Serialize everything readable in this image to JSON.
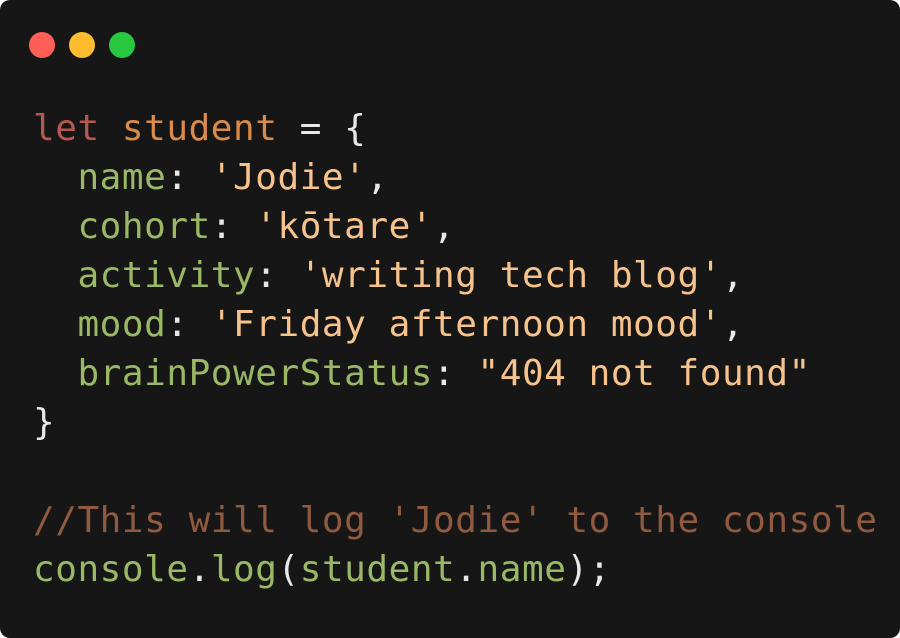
{
  "window": {
    "controls": [
      {
        "name": "close",
        "color": "#ff5f57"
      },
      {
        "name": "minimize",
        "color": "#febc2e"
      },
      {
        "name": "maximize",
        "color": "#28c840"
      }
    ]
  },
  "code": {
    "lines": [
      {
        "tokens": [
          {
            "type": "kw",
            "text": "let"
          },
          {
            "type": "punc",
            "text": " "
          },
          {
            "type": "var",
            "text": "student"
          },
          {
            "type": "punc",
            "text": " = {"
          }
        ]
      },
      {
        "tokens": [
          {
            "type": "punc",
            "text": "  "
          },
          {
            "type": "prop",
            "text": "name"
          },
          {
            "type": "punc",
            "text": ": "
          },
          {
            "type": "str",
            "text": "'Jodie'"
          },
          {
            "type": "punc",
            "text": ","
          }
        ]
      },
      {
        "tokens": [
          {
            "type": "punc",
            "text": "  "
          },
          {
            "type": "prop",
            "text": "cohort"
          },
          {
            "type": "punc",
            "text": ": "
          },
          {
            "type": "str",
            "text": "'kōtare'"
          },
          {
            "type": "punc",
            "text": ","
          }
        ]
      },
      {
        "tokens": [
          {
            "type": "punc",
            "text": "  "
          },
          {
            "type": "prop",
            "text": "activity"
          },
          {
            "type": "punc",
            "text": ": "
          },
          {
            "type": "str",
            "text": "'writing tech blog'"
          },
          {
            "type": "punc",
            "text": ","
          }
        ]
      },
      {
        "tokens": [
          {
            "type": "punc",
            "text": "  "
          },
          {
            "type": "prop",
            "text": "mood"
          },
          {
            "type": "punc",
            "text": ": "
          },
          {
            "type": "str",
            "text": "'Friday afternoon mood'"
          },
          {
            "type": "punc",
            "text": ","
          }
        ]
      },
      {
        "tokens": [
          {
            "type": "punc",
            "text": "  "
          },
          {
            "type": "prop",
            "text": "brainPowerStatus"
          },
          {
            "type": "punc",
            "text": ": "
          },
          {
            "type": "str",
            "text": "\"404 not found\""
          }
        ]
      },
      {
        "tokens": [
          {
            "type": "punc",
            "text": "}"
          }
        ]
      },
      {
        "tokens": []
      },
      {
        "tokens": [
          {
            "type": "cmt",
            "text": "//This will log 'Jodie' to the console"
          }
        ]
      },
      {
        "tokens": [
          {
            "type": "prop",
            "text": "console"
          },
          {
            "type": "punc",
            "text": "."
          },
          {
            "type": "prop",
            "text": "log"
          },
          {
            "type": "punc",
            "text": "("
          },
          {
            "type": "prop",
            "text": "student"
          },
          {
            "type": "punc",
            "text": "."
          },
          {
            "type": "prop",
            "text": "name"
          },
          {
            "type": "punc",
            "text": ");"
          }
        ]
      }
    ]
  }
}
